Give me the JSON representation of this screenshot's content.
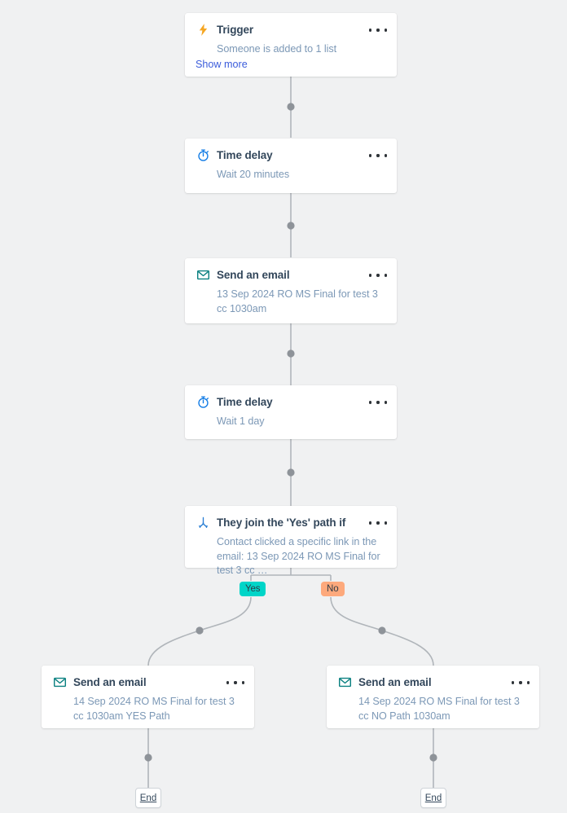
{
  "workflow": {
    "nodes": [
      {
        "id": "trigger",
        "icon": "lightning-bolt-icon",
        "title": "Trigger",
        "body": "Someone is added to 1 list",
        "link": "Show more",
        "menu": "more-options"
      },
      {
        "id": "time-delay-1",
        "icon": "stopwatch-icon",
        "title": "Time delay",
        "body": "Wait 20 minutes",
        "menu": "more-options"
      },
      {
        "id": "send-email-1",
        "icon": "envelope-icon",
        "title": "Send an email",
        "body": "13 Sep 2024 RO MS Final for test 3 cc 1030am",
        "menu": "more-options"
      },
      {
        "id": "time-delay-2",
        "icon": "stopwatch-icon",
        "title": "Time delay",
        "body": "Wait 1 day",
        "menu": "more-options"
      },
      {
        "id": "branch",
        "icon": "branch-split-icon",
        "title": "They join the 'Yes' path if",
        "body": "Contact clicked a specific link in the email: 13 Sep 2024 RO MS Final for test 3 cc …",
        "menu": "more-options"
      },
      {
        "id": "send-email-yes",
        "icon": "envelope-icon",
        "title": "Send an email",
        "body": "14 Sep 2024 RO MS Final for test 3 cc 1030am YES Path",
        "menu": "more-options"
      },
      {
        "id": "send-email-no",
        "icon": "envelope-icon",
        "title": "Send an email",
        "body": "14 Sep 2024 RO MS Final for test 3 cc NO Path 1030am",
        "menu": "more-options"
      }
    ],
    "branch_labels": {
      "yes": "Yes",
      "no": "No"
    },
    "end_nodes": {
      "left": "End",
      "right": "End"
    },
    "colors": {
      "canvas": "#f0f1f2",
      "card": "#ffffff",
      "title_text": "#33475b",
      "body_text": "#7c98b6",
      "link": "#3b5cdb",
      "connector": "#b0b5ba",
      "connector_dot": "#8e9399",
      "trigger_icon": "#f5a623",
      "delay_icon": "#0f7ae5",
      "email_icon": "#0a8080",
      "branch_icon": "#2b7fd4",
      "badge_yes": "#00d5c8",
      "badge_no": "#fda97c"
    }
  }
}
